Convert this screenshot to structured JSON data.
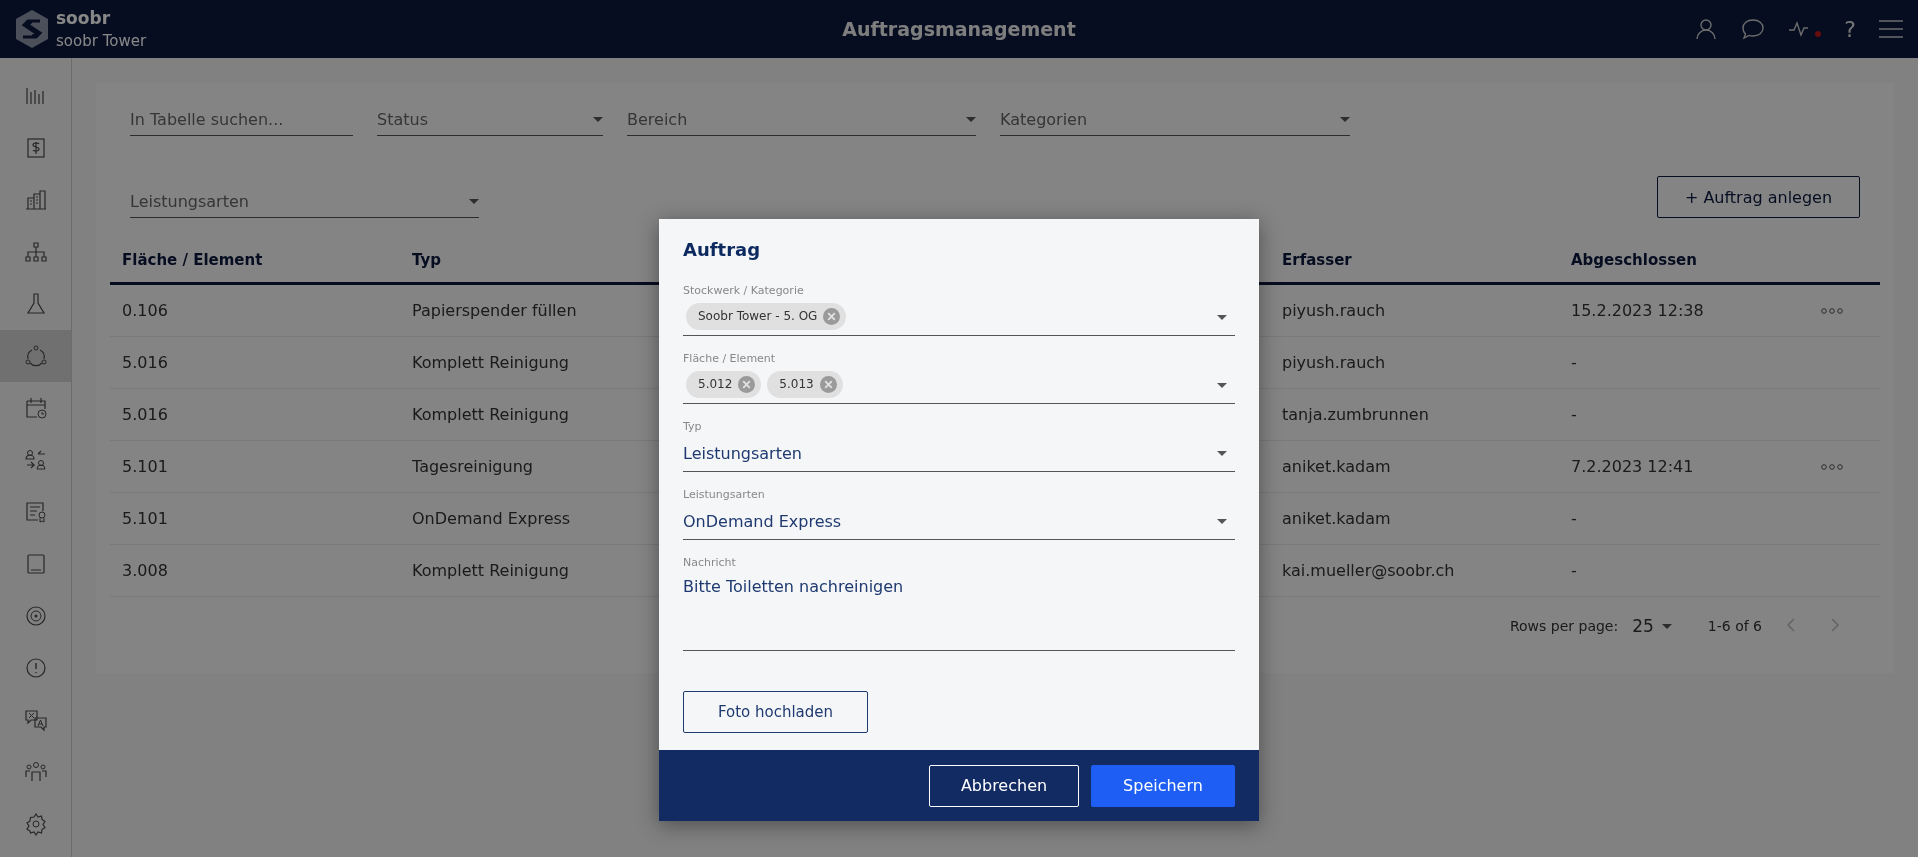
{
  "header": {
    "app_name": "soobr",
    "site_name": "soobr Tower",
    "title": "Auftragsmanagement",
    "help": "?"
  },
  "sidebar": [
    {
      "selected": false
    },
    {
      "selected": false
    },
    {
      "selected": false
    },
    {
      "selected": false
    },
    {
      "selected": false
    },
    {
      "selected": true
    },
    {
      "selected": false
    },
    {
      "selected": false
    },
    {
      "selected": false
    },
    {
      "selected": false
    },
    {
      "selected": false
    },
    {
      "selected": false
    },
    {
      "selected": false
    },
    {
      "selected": false
    },
    {
      "selected": false
    }
  ],
  "filters": [
    {
      "kind": "search",
      "placeholder": "In Tabelle suchen..."
    },
    {
      "kind": "select",
      "placeholder": "Status"
    },
    {
      "kind": "select",
      "placeholder": "Bereich"
    },
    {
      "kind": "select",
      "placeholder": "Kategorien"
    },
    {
      "kind": "select",
      "placeholder": "Leistungsarten"
    }
  ],
  "create_button": "+ Auftrag anlegen",
  "table": {
    "columns": [
      "Fläche / Element",
      "Typ",
      "Erfasser",
      "Abgeschlossen"
    ],
    "rows": [
      {
        "cells": [
          "0.106",
          "Papierspender füllen",
          "piyush.rauch",
          "15.2.2023 12:38"
        ],
        "has_menu": true
      },
      {
        "cells": [
          "5.016",
          "Komplett Reinigung",
          "piyush.rauch",
          "-"
        ],
        "has_menu": false
      },
      {
        "cells": [
          "5.016",
          "Komplett Reinigung",
          "tanja.zumbrunnen",
          "-"
        ],
        "has_menu": false
      },
      {
        "cells": [
          "5.101",
          "Tagesreinigung",
          "aniket.kadam",
          "7.2.2023 12:41"
        ],
        "has_menu": true
      },
      {
        "cells": [
          "5.101",
          "OnDemand Express",
          "aniket.kadam",
          "-"
        ],
        "has_menu": false
      },
      {
        "cells": [
          "3.008",
          "Komplett Reinigung",
          "kai.mueller@soobr.ch",
          "-"
        ],
        "has_menu": false
      }
    ]
  },
  "pagination": {
    "rows_per_page_label": "Rows per page:",
    "rows_per_page": "25",
    "range": "1-6 of 6"
  },
  "modal": {
    "title": "Auftrag",
    "fields": [
      {
        "kind": "chips",
        "label": "Stockwerk / Kategorie",
        "chips": [
          "Soobr Tower - 5. OG"
        ]
      },
      {
        "kind": "chips",
        "label": "Fläche / Element",
        "chips": [
          "5.012",
          "5.013"
        ]
      },
      {
        "kind": "select",
        "label": "Typ",
        "value": "Leistungsarten"
      },
      {
        "kind": "select",
        "label": "Leistungsarten",
        "value": "OnDemand Express"
      },
      {
        "kind": "textarea",
        "label": "Nachricht",
        "value": "Bitte Toiletten nachreinigen"
      }
    ],
    "upload_button": "Foto hochladen",
    "cancel_button": "Abbrechen",
    "save_button": "Speichern"
  }
}
